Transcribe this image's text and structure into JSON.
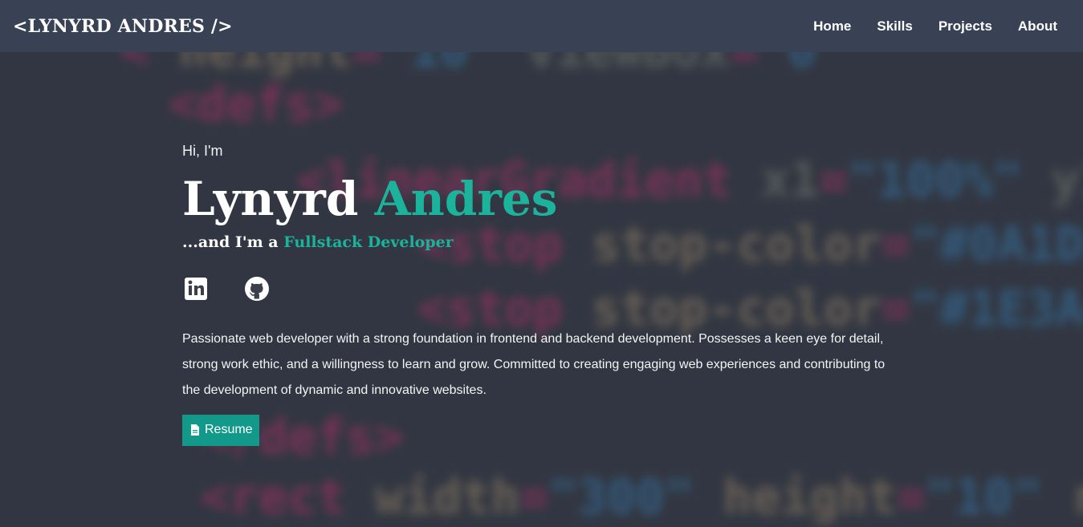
{
  "navbar": {
    "brand": "<LYNYRD ANDRES />",
    "links": [
      "Home",
      "Skills",
      "Projects",
      "About"
    ]
  },
  "hero": {
    "greeting": "Hi, I'm",
    "first_name": "Lynyrd",
    "last_name": "Andres",
    "role_prefix": "...and I'm a",
    "role": "Fullstack Developer",
    "bio": "Passionate web developer with a strong foundation in frontend and backend development. Possesses a keen eye for detail, strong work ethic, and a willingness to learn and grow. Committed to creating engaging web experiences and contributing to the development of dynamic and innovative websites.",
    "resume_label": "Resume"
  },
  "socials": [
    {
      "icon": "linkedin-icon"
    },
    {
      "icon": "github-icon"
    }
  ],
  "colors": {
    "accent": "#1bb39b",
    "navbar_bg": "#394254",
    "button_bg": "#13998a"
  }
}
